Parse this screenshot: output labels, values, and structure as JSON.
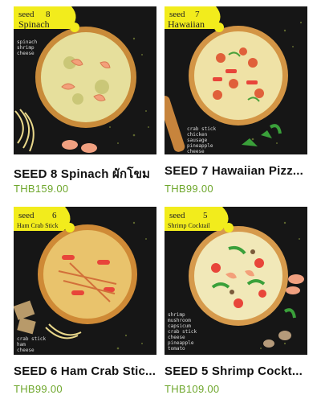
{
  "products": [
    {
      "label_line1": "seed",
      "label_num": "8",
      "label_line2": "Spinach",
      "ingredients": [
        "spinach",
        "shrimp",
        "cheese"
      ],
      "name": "SEED 8  Spinach  ผักโขม",
      "price": "THB159.00",
      "cheese_color": "#e6df9c",
      "crust_color": "#c98b3a"
    },
    {
      "label_line1": "seed",
      "label_num": "7",
      "label_line2": "Hawaiian",
      "ingredients": [
        "crab stick",
        "chicken",
        "sausage",
        "pineapple",
        "cheese"
      ],
      "name": "SEED 7  Hawaiian Pizz...",
      "price": "THB99.00",
      "cheese_color": "#efe2a6",
      "crust_color": "#d39545"
    },
    {
      "label_line1": "seed",
      "label_num": "6",
      "label_line2": "Ham Crab Stick",
      "ingredients": [
        "crab stick",
        "ham",
        "cheese"
      ],
      "name": "SEED 6  Ham Crab Stic...",
      "price": "THB99.00",
      "cheese_color": "#e9c36c",
      "crust_color": "#cf8a36"
    },
    {
      "label_line1": "seed",
      "label_num": "5",
      "label_line2": "Shrimp Cocktail",
      "ingredients": [
        "shrimp",
        "mushroom",
        "capsicum",
        "crab stick",
        "cheese",
        "pineapple",
        "tomato"
      ],
      "name": "SEED 5  Shrimp Cockt...",
      "price": "THB109.00",
      "cheese_color": "#f1e8b8",
      "crust_color": "#d69a4c"
    }
  ],
  "colors": {
    "label_yellow": "#f2ec1c",
    "price_green": "#6ea72c",
    "board_dark": "#161616"
  }
}
